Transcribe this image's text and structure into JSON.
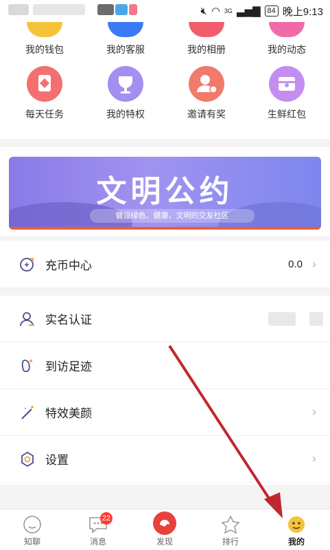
{
  "status_bar": {
    "time": "晚上9:13",
    "battery": "84",
    "network": "3G"
  },
  "grid": {
    "row1": [
      {
        "label": "我的钱包",
        "icon": "wallet-icon",
        "color": "#f5c23a"
      },
      {
        "label": "我的客服",
        "icon": "customer-service-icon",
        "color": "#3a7bf5"
      },
      {
        "label": "我的相册",
        "icon": "album-icon",
        "color": "#f25d6b"
      },
      {
        "label": "我的动态",
        "icon": "moments-icon",
        "color": "#f06aa8"
      }
    ],
    "row2": [
      {
        "label": "每天任务",
        "icon": "daily-task-icon",
        "color": "#f26b6b"
      },
      {
        "label": "我的特权",
        "icon": "privilege-trophy-icon",
        "color": "#a38ef2"
      },
      {
        "label": "邀请有奖",
        "icon": "invite-user-icon",
        "color": "#f27a6b"
      },
      {
        "label": "生鲜红包",
        "icon": "fresh-redpacket-icon",
        "color": "#c48ef0"
      }
    ]
  },
  "banner": {
    "title": "文明公约",
    "subtitle": "健设绿色、健康、文明的交友社区"
  },
  "recharge": {
    "label": "充币中心",
    "value": "0.0",
    "icon": "recharge-icon"
  },
  "menu": [
    {
      "label": "实名认证",
      "icon": "real-name-icon"
    },
    {
      "label": "到访足迹",
      "icon": "footprint-icon"
    },
    {
      "label": "特效美颜",
      "icon": "magic-wand-icon"
    },
    {
      "label": "设置",
      "icon": "settings-icon"
    }
  ],
  "nav": [
    {
      "label": "知聊",
      "icon": "chat-face-icon"
    },
    {
      "label": "消息",
      "icon": "message-icon",
      "badge": "22"
    },
    {
      "label": "发现",
      "icon": "discover-icon"
    },
    {
      "label": "排行",
      "icon": "ranking-icon"
    },
    {
      "label": "我的",
      "icon": "me-icon"
    }
  ]
}
